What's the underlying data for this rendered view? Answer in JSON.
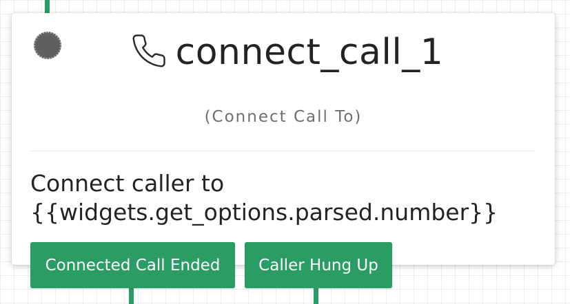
{
  "widget": {
    "name": "connect_call_1",
    "type_label": "(Connect Call To)",
    "icon": "phone-icon",
    "description_line1": "Connect caller to",
    "description_line2": "{{widgets.get_options.parsed.number}}"
  },
  "transitions": [
    {
      "label": "Connected Call Ended"
    },
    {
      "label": "Caller Hung Up"
    }
  ],
  "colors": {
    "accent": "#2a9d64",
    "status_dot": "#5f5f5f",
    "title_text": "#232323",
    "subtitle_text": "#6f6f6f"
  }
}
